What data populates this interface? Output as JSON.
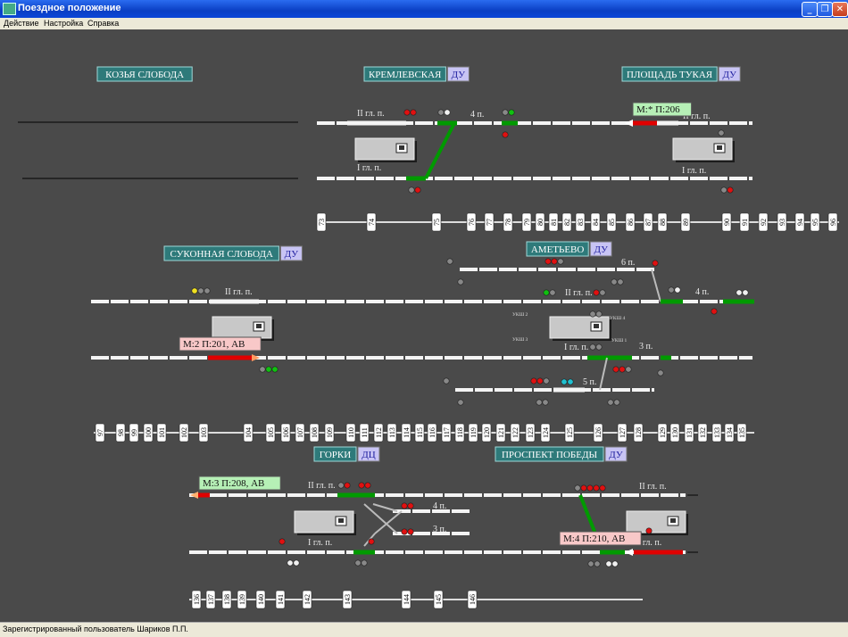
{
  "window": {
    "title": "Поездное положение"
  },
  "menu": {
    "items": [
      "Действие",
      "Настройка",
      "Справка"
    ]
  },
  "status": {
    "user": "Зарегистрированный пользователь Шариков П.П."
  },
  "stations": {
    "kozya": {
      "name": "КОЗЬЯ СЛОБОДА"
    },
    "kreml": {
      "name": "КРЕМЛЕВСКАЯ",
      "mode": "ДУ"
    },
    "tukaya": {
      "name": "ПЛОЩАДЬ ТУКАЯ",
      "mode": "ДУ"
    },
    "sukon": {
      "name": "СУКОННАЯ СЛОБОДА",
      "mode": "ДУ"
    },
    "amet": {
      "name": "АМЕТЬЕВО",
      "mode": "ДУ"
    },
    "gorki": {
      "name": "ГОРКИ",
      "mode": "ДЦ"
    },
    "pobedy": {
      "name": "ПРОСПЕКТ ПОБЕДЫ",
      "mode": "ДУ"
    }
  },
  "tracks": {
    "t_kr_2": "II гл. п.",
    "t_kr_4": "4 п.",
    "t_kr_1": "I гл. п.",
    "t_tu_2": "II гл. п.",
    "t_tu_1": "I гл. п.",
    "t_su_2": "II гл. п.",
    "t_am_6": "6 п.",
    "t_am_2": "II гл. п.",
    "t_am_4": "4 п.",
    "t_am_1": "I гл. п.",
    "t_am_3": "3 п.",
    "t_am_5": "5 п.",
    "t_go_2": "II гл. п.",
    "t_go_4": "4 п.",
    "t_go_3": "3 п.",
    "t_go_1": "I гл. п.",
    "t_pp_2": "II гл. п.",
    "t_pp_1": "I гл. п."
  },
  "trains": {
    "tr1": "М:* П:206",
    "tr2": "М:2 П:201, АВ",
    "tr3": "М:3 П:208, АВ",
    "tr4": "М:4 П:210, АВ"
  },
  "small_labels": {
    "u1": "УКШ 2",
    "u2": "УКШ 4",
    "u3": "УКШ 3",
    "u4": "УКШ 1"
  },
  "pickets": {
    "row1": [
      "73",
      "74",
      "75",
      "76",
      "77",
      "78",
      "79",
      "80",
      "81",
      "82",
      "83",
      "84",
      "85",
      "86",
      "87",
      "88",
      "89",
      "90",
      "91",
      "92",
      "93",
      "94",
      "95",
      "96"
    ],
    "row2": [
      "97",
      "98",
      "99",
      "100",
      "101",
      "102",
      "103",
      "104",
      "105",
      "106",
      "107",
      "108",
      "109",
      "110",
      "111",
      "112",
      "113",
      "114",
      "115",
      "116",
      "117",
      "118",
      "119",
      "120",
      "121",
      "122",
      "123",
      "124",
      "125",
      "126",
      "127",
      "128",
      "129",
      "130",
      "131",
      "132",
      "133",
      "134",
      "135"
    ],
    "row3": [
      "136",
      "137",
      "138",
      "139",
      "140",
      "141",
      "142",
      "143",
      "144",
      "145",
      "146"
    ]
  },
  "colors": {
    "background": "#4a4a4a",
    "occupied": "#e00000",
    "route": "#009a00",
    "station_box": "#2e7a7a",
    "mode_box": "#c8c4f4"
  }
}
